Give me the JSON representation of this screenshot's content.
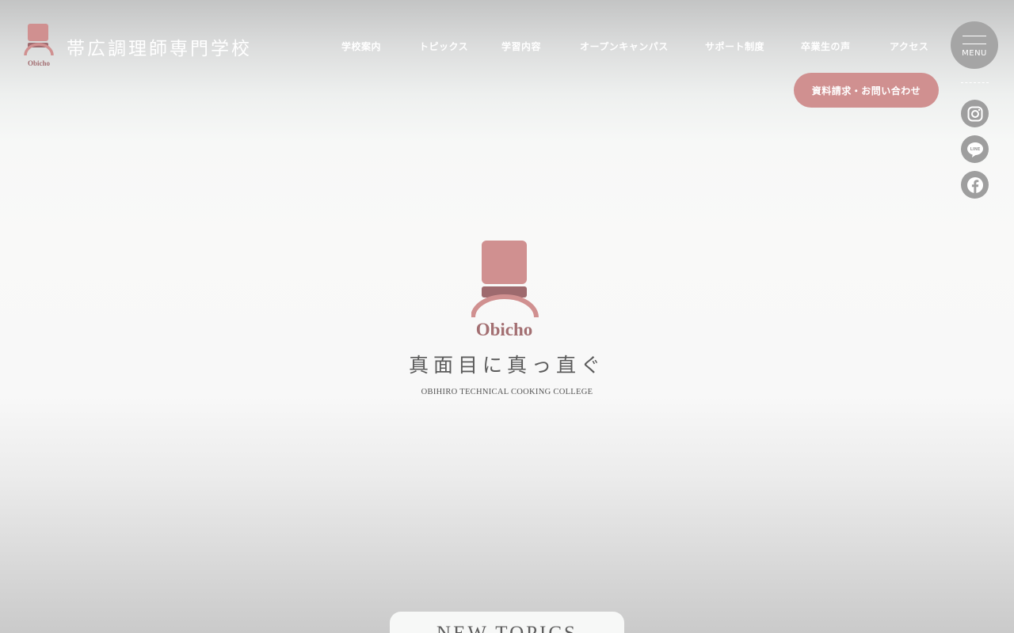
{
  "brand": {
    "logo_word": "Obicho",
    "school_name": "帯広調理師専門学校",
    "tagline": "真面目に真っ直ぐ",
    "english_name": "OBIHIRO TECHNICAL COOKING COLLEGE",
    "color": "#d09090"
  },
  "nav": {
    "items": [
      "学校案内",
      "トピックス",
      "学習内容",
      "オープンキャンパス",
      "サポート制度",
      "卒業生の声",
      "アクセス"
    ],
    "cta_label": "資料請求・お問い合わせ",
    "menu_label": "MENU"
  },
  "social": {
    "icons": [
      "instagram-icon",
      "line-icon",
      "facebook-icon"
    ],
    "line_text": "LINE"
  },
  "topics": {
    "heading": "NEW TOPICS"
  }
}
